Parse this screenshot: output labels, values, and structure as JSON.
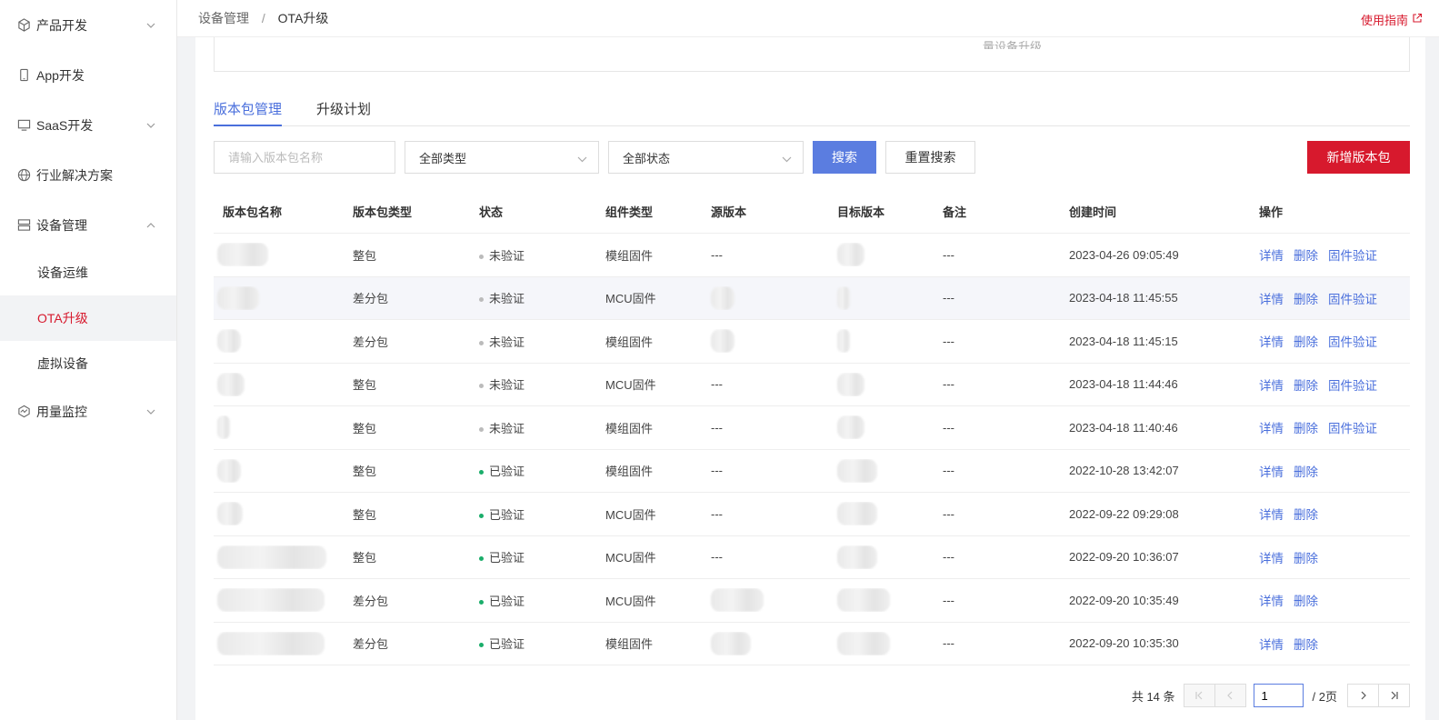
{
  "sidebar": {
    "items": [
      {
        "label": "产品开发",
        "icon": "cube-icon",
        "chevron": "down"
      },
      {
        "label": "App开发",
        "icon": "phone-icon",
        "chevron": ""
      },
      {
        "label": "SaaS开发",
        "icon": "monitor-icon",
        "chevron": "down"
      },
      {
        "label": "行业解决方案",
        "icon": "globe-icon",
        "chevron": ""
      },
      {
        "label": "设备管理",
        "icon": "server-icon",
        "chevron": "up"
      }
    ],
    "device_sub": [
      "设备运维",
      "OTA升级",
      "虚拟设备"
    ],
    "usage": {
      "label": "用量监控",
      "icon": "monitor-wave-icon"
    }
  },
  "breadcrumb": {
    "parent": "设备管理",
    "sep": "/",
    "current": "OTA升级"
  },
  "guide_link": "使用指南",
  "upper_faded_text": "量设备升级",
  "tabs": [
    "版本包管理",
    "升级计划"
  ],
  "filters": {
    "search_placeholder": "请输入版本包名称",
    "type_select": "全部类型",
    "status_select": "全部状态",
    "search_btn": "搜索",
    "reset_btn": "重置搜索",
    "add_btn": "新增版本包"
  },
  "table": {
    "headers": [
      "版本包名称",
      "版本包类型",
      "状态",
      "组件类型",
      "源版本",
      "目标版本",
      "备注",
      "创建时间",
      "操作"
    ],
    "rows": [
      {
        "type": "整包",
        "status": "未验证",
        "comp": "模组固件",
        "src": "---",
        "note": "---",
        "time": "2023-04-26 09:05:49",
        "verify": true
      },
      {
        "type": "差分包",
        "status": "未验证",
        "comp": "MCU固件",
        "src": "",
        "note": "---",
        "time": "2023-04-18 11:45:55",
        "verify": true
      },
      {
        "type": "差分包",
        "status": "未验证",
        "comp": "模组固件",
        "src": "",
        "note": "---",
        "time": "2023-04-18 11:45:15",
        "verify": true
      },
      {
        "type": "整包",
        "status": "未验证",
        "comp": "MCU固件",
        "src": "---",
        "note": "---",
        "time": "2023-04-18 11:44:46",
        "verify": true
      },
      {
        "type": "整包",
        "status": "未验证",
        "comp": "模组固件",
        "src": "---",
        "note": "---",
        "time": "2023-04-18 11:40:46",
        "verify": true
      },
      {
        "type": "整包",
        "status": "已验证",
        "comp": "模组固件",
        "src": "---",
        "note": "---",
        "time": "2022-10-28 13:42:07",
        "verify": false
      },
      {
        "type": "整包",
        "status": "已验证",
        "comp": "MCU固件",
        "src": "---",
        "note": "---",
        "time": "2022-09-22 09:29:08",
        "verify": false
      },
      {
        "type": "整包",
        "status": "已验证",
        "comp": "MCU固件",
        "src": "---",
        "note": "---",
        "time": "2022-09-20 10:36:07",
        "verify": false
      },
      {
        "type": "差分包",
        "status": "已验证",
        "comp": "MCU固件",
        "src": "",
        "note": "---",
        "time": "2022-09-20 10:35:49",
        "verify": false
      },
      {
        "type": "差分包",
        "status": "已验证",
        "comp": "模组固件",
        "src": "",
        "note": "---",
        "time": "2022-09-20 10:35:30",
        "verify": false
      }
    ],
    "ops": {
      "detail": "详情",
      "delete": "删除",
      "verify": "固件验证"
    }
  },
  "pagination": {
    "total": "共 14 条",
    "current": "1",
    "pages": "/ 2页"
  },
  "colors": {
    "accent": "#4a6fdc",
    "brand_red": "#d7192d",
    "verified": "#1aad6a",
    "unverified": "#bbbbbb"
  }
}
